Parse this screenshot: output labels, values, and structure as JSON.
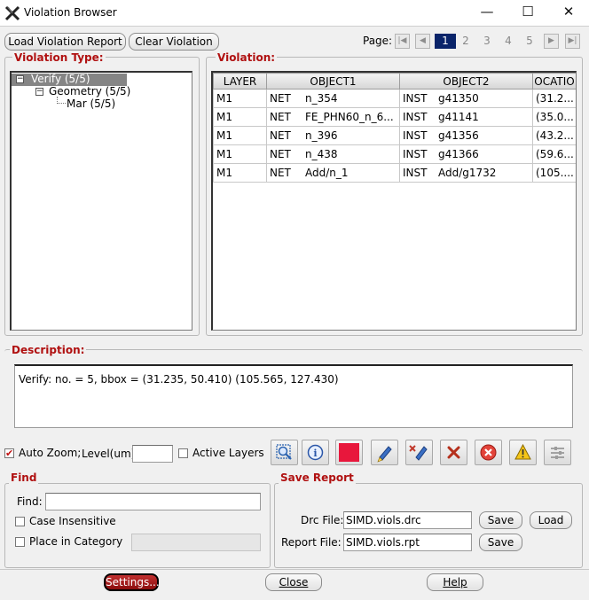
{
  "window": {
    "title": "Violation Browser",
    "minimize": "—",
    "maximize": "☐",
    "close": "✕"
  },
  "toolbar": {
    "load_label": "Load Violation Report",
    "clear_label": "Clear Violation"
  },
  "pager": {
    "label": "Page:",
    "current": "1",
    "pages": [
      "2",
      "3",
      "4",
      "5"
    ]
  },
  "violation_type": {
    "title": "Violation Type:",
    "tree": {
      "root": "Verify (5/5)",
      "child": "Geometry (5/5)",
      "leaf": "Mar (5/5)"
    }
  },
  "violation": {
    "title": "Violation:",
    "columns": [
      "LAYER",
      "OBJECT1",
      "OBJECT2",
      "OCATIO"
    ],
    "rows": [
      {
        "layer": "M1",
        "t1": "NET",
        "o1": "n_354",
        "t2": "INST",
        "o2": "g41350",
        "loc": "(31.2..."
      },
      {
        "layer": "M1",
        "t1": "NET",
        "o1": "FE_PHN60_n_6...",
        "t2": "INST",
        "o2": "g41141",
        "loc": "(35.0..."
      },
      {
        "layer": "M1",
        "t1": "NET",
        "o1": "n_396",
        "t2": "INST",
        "o2": "g41356",
        "loc": "(43.2..."
      },
      {
        "layer": "M1",
        "t1": "NET",
        "o1": "n_438",
        "t2": "INST",
        "o2": "g41366",
        "loc": "(59.6..."
      },
      {
        "layer": "M1",
        "t1": "NET",
        "o1": "Add/n_1",
        "t2": "INST",
        "o2": "Add/g1732",
        "loc": "(105...."
      }
    ]
  },
  "description": {
    "title": "Description:",
    "text": "Verify: no. = 5, bbox = (31.235, 50.410) (105.565, 127.430)"
  },
  "options": {
    "auto_zoom_label": "Auto Zoom;",
    "level_label": "Level(um)",
    "level_value": "",
    "active_layers_label": "Active Layers",
    "auto_zoom_checked": true,
    "active_layers_checked": false
  },
  "tool_icons": [
    "zoom-fit-icon",
    "info-icon",
    "color-swatch",
    "highlight-pen-icon",
    "clear-highlight-icon",
    "delete-x-icon",
    "delete-all-icon",
    "warning-icon",
    "settings-sliders-icon"
  ],
  "swatch_color": "#e8173c",
  "find": {
    "title": "Find",
    "find_label": "Find:",
    "find_value": "",
    "case_label": "Case Insensitive",
    "category_label": "Place in Category"
  },
  "save_report": {
    "title": "Save Report",
    "drc_label": "Drc File:",
    "drc_value": "SIMD.viols.drc",
    "report_label": "Report File:",
    "report_value": "SIMD.viols.rpt",
    "save_label": "Save",
    "load_label": "Load"
  },
  "footer": {
    "settings_label": "Settings...",
    "close_label": "Close",
    "help_label": "Help"
  }
}
